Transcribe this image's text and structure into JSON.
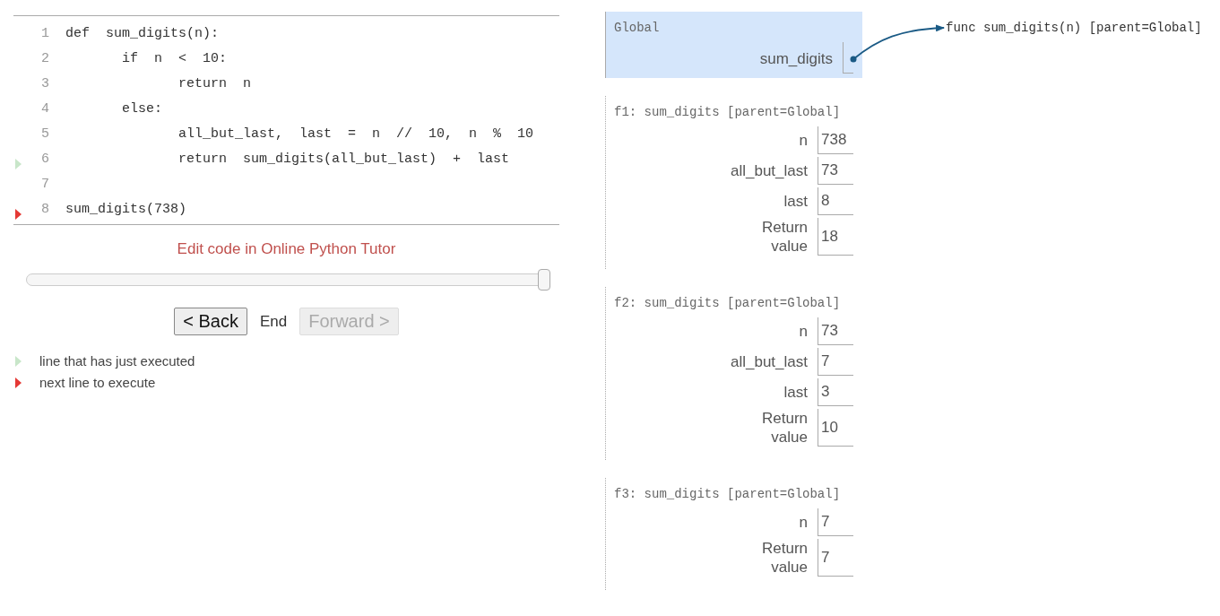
{
  "code": {
    "lines": [
      {
        "number": "1",
        "text": "def  sum_digits(n):",
        "just_executed": false,
        "next_to_execute": false
      },
      {
        "number": "2",
        "text": "       if  n  <  10:",
        "just_executed": false,
        "next_to_execute": false
      },
      {
        "number": "3",
        "text": "              return  n",
        "just_executed": false,
        "next_to_execute": false
      },
      {
        "number": "4",
        "text": "       else:",
        "just_executed": false,
        "next_to_execute": false
      },
      {
        "number": "5",
        "text": "              all_but_last,  last  =  n  //  10,  n  %  10",
        "just_executed": false,
        "next_to_execute": false
      },
      {
        "number": "6",
        "text": "              return  sum_digits(all_but_last)  +  last",
        "just_executed": true,
        "next_to_execute": false
      },
      {
        "number": "7",
        "just_executed": false,
        "next_to_execute": false
      },
      {
        "number": "8",
        "text": "sum_digits(738)",
        "just_executed": false,
        "next_to_execute": true
      }
    ]
  },
  "edit_link": "Edit code in Online Python Tutor",
  "slider": {
    "level": 1
  },
  "controls": [
    {
      "kind": "button",
      "label": "< Back",
      "disabled": false
    },
    {
      "kind": "text",
      "label": "End"
    },
    {
      "kind": "button",
      "label": "Forward >",
      "disabled": true
    }
  ],
  "legend": [
    {
      "kind": "executed",
      "label": "line that has just executed"
    },
    {
      "kind": "next",
      "label": "next line to execute"
    }
  ],
  "frames": [
    {
      "title": "Global",
      "highlighted": true,
      "vars": [
        {
          "name": "sum_digits",
          "kind": "pointer"
        }
      ]
    },
    {
      "title": "f1: sum_digits [parent=Global]",
      "highlighted": false,
      "vars": [
        {
          "name": "n",
          "kind": "value",
          "value": "738"
        },
        {
          "name": "all_but_last",
          "kind": "value",
          "value": "73"
        },
        {
          "name": "last",
          "kind": "value",
          "value": "8"
        },
        {
          "name": "Return value",
          "kind": "value",
          "value": "18"
        }
      ]
    },
    {
      "title": "f2: sum_digits [parent=Global]",
      "highlighted": false,
      "vars": [
        {
          "name": "n",
          "kind": "value",
          "value": "73"
        },
        {
          "name": "all_but_last",
          "kind": "value",
          "value": "7"
        },
        {
          "name": "last",
          "kind": "value",
          "value": "3"
        },
        {
          "name": "Return value",
          "kind": "value",
          "value": "10"
        }
      ]
    },
    {
      "title": "f3: sum_digits [parent=Global]",
      "highlighted": false,
      "vars": [
        {
          "name": "n",
          "kind": "value",
          "value": "7"
        },
        {
          "name": "Return value",
          "kind": "value",
          "value": "7"
        }
      ]
    }
  ],
  "heap": [
    {
      "text": "func sum_digits(n) [parent=Global]"
    }
  ]
}
